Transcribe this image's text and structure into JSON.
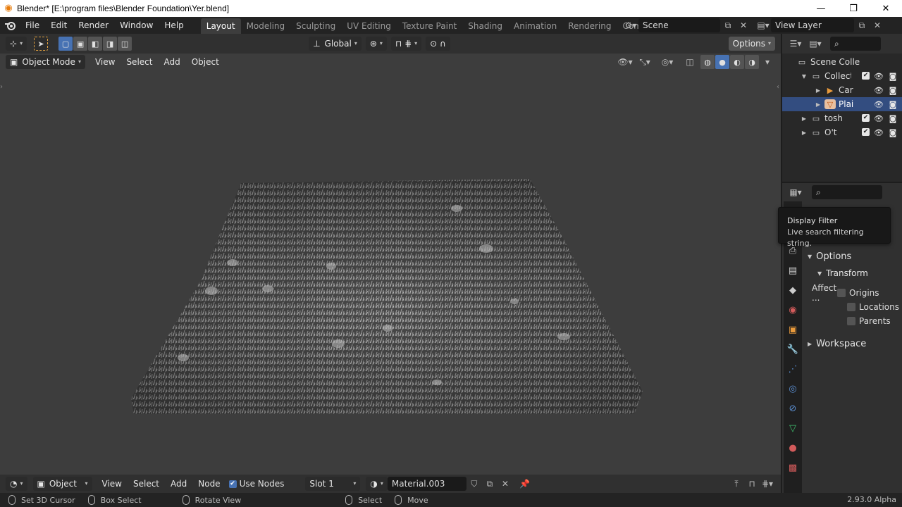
{
  "window": {
    "title": "Blender* [E:\\program files\\Blender Foundation\\Yer.blend]",
    "minimize": "—",
    "maximize": "❐",
    "close": "✕"
  },
  "menus": [
    "File",
    "Edit",
    "Render",
    "Window",
    "Help"
  ],
  "workspaces": {
    "tabs": [
      "Layout",
      "Modeling",
      "Sculpting",
      "UV Editing",
      "Texture Paint",
      "Shading",
      "Animation",
      "Rendering",
      "Compositing"
    ],
    "active": "Layout"
  },
  "scene": {
    "name": "Scene"
  },
  "view_layer": {
    "name": "View Layer"
  },
  "tool_header": {
    "orientation": "Global",
    "options_label": "Options"
  },
  "viewport_header": {
    "mode": "Object Mode",
    "menu": [
      "View",
      "Select",
      "Add",
      "Object"
    ]
  },
  "outliner": {
    "rows": [
      {
        "name": "Scene Colle",
        "icon": "scene-collection-icon"
      },
      {
        "name": "Collecti",
        "icon": "collection-icon"
      },
      {
        "name": "Car",
        "icon": "camera-icon"
      },
      {
        "name": "Plai",
        "icon": "mesh-icon"
      },
      {
        "name": "tosh",
        "icon": "collection-icon"
      },
      {
        "name": "O't",
        "icon": "collection-icon"
      }
    ]
  },
  "properties": {
    "options_title": "Options",
    "transform_title": "Transform",
    "affect_label": "Affect ...",
    "checkboxes": [
      "Origins",
      "Locations",
      "Parents"
    ],
    "workspace_title": "Workspace"
  },
  "tooltip": {
    "title": "Display Filter",
    "desc": "Live search filtering string."
  },
  "shader_header": {
    "object_type": "Object",
    "menu": [
      "View",
      "Select",
      "Add",
      "Node"
    ],
    "use_nodes": "Use Nodes",
    "slot": "Slot 1",
    "material": "Material.003"
  },
  "statusbar": {
    "items": [
      "Set 3D Cursor",
      "Box Select",
      "Rotate View",
      "Select",
      "Move"
    ],
    "version": "2.93.0 Alpha"
  },
  "colors": {
    "accent_blue": "#4772b3",
    "selected_row": "#334d80",
    "viewport_bg": "#3d3d3d"
  }
}
